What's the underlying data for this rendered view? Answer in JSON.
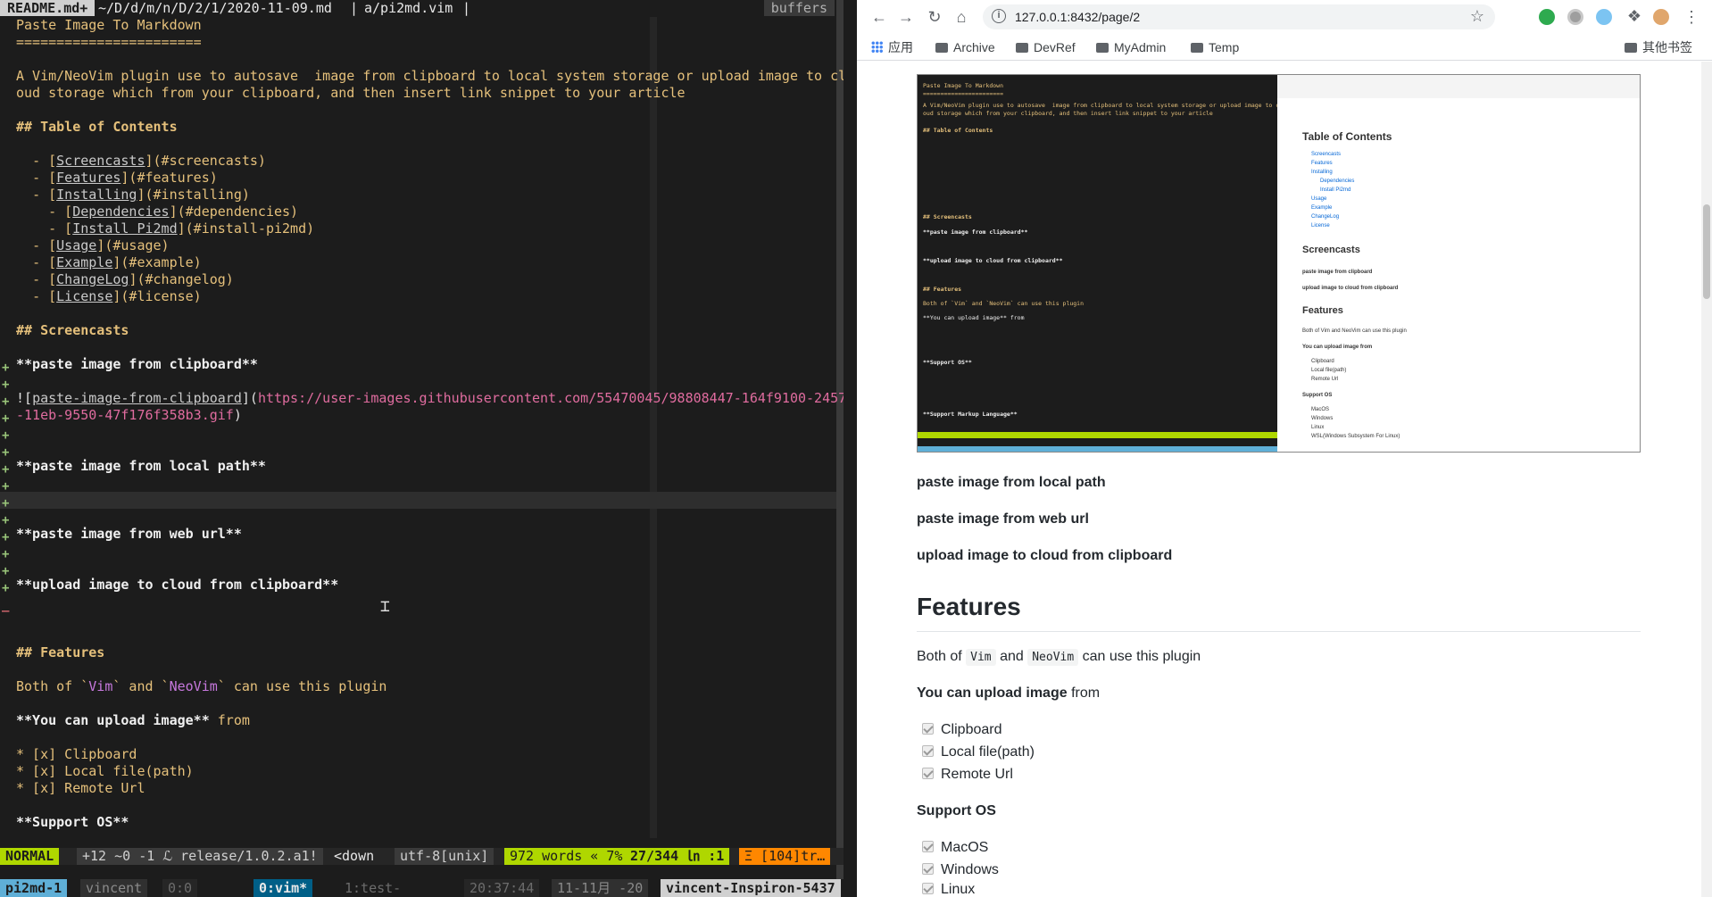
{
  "vim": {
    "tabline": {
      "active_tab": "README.md+",
      "path": "~/D/d/m/n/D/2/1/2020-11-09.md",
      "sep1": "|",
      "second_tab": "a/pi2md.vim",
      "sep2": "|",
      "buffers": "buffers"
    },
    "lines": {
      "l1": "Paste Image To Markdown",
      "l2": "=======================",
      "l3a": "A Vim/NeoVim plugin use to autosave  image from clipboard to local system storage or upload image to cl",
      "l3b": "oud storage which from your clipboard, and then insert link snippet to your article",
      "toc_heading": "## Table of Contents",
      "toc": [
        {
          "indent": "  ",
          "bracket_open": "- [",
          "label": "Screencasts",
          "target": "](#screencasts)"
        },
        {
          "indent": "  ",
          "bracket_open": "- [",
          "label": "Features",
          "target": "](#features)"
        },
        {
          "indent": "  ",
          "bracket_open": "- [",
          "label": "Installing",
          "target": "](#installing)"
        },
        {
          "indent": "    ",
          "bracket_open": "- [",
          "label": "Dependencies",
          "target": "](#dependencies)"
        },
        {
          "indent": "    ",
          "bracket_open": "- [",
          "label": "Install Pi2md",
          "target": "](#install-pi2md)"
        },
        {
          "indent": "  ",
          "bracket_open": "- [",
          "label": "Usage",
          "target": "](#usage)"
        },
        {
          "indent": "  ",
          "bracket_open": "- [",
          "label": "Example",
          "target": "](#example)"
        },
        {
          "indent": "  ",
          "bracket_open": "- [",
          "label": "ChangeLog",
          "target": "](#changelog)"
        },
        {
          "indent": "  ",
          "bracket_open": "- [",
          "label": "License",
          "target": "](#license)"
        }
      ],
      "screencasts": "## Screencasts",
      "paste_clipboard": "**paste image from clipboard**",
      "img_prefix": "![",
      "img_label": "paste-image-from-clipboard",
      "img_mid": "](",
      "img_url_a": "https://user-images.githubusercontent.com/55470045/98808447-164f9100-2457",
      "img_url_b": "-11eb-9550-47f176f358b3.gif",
      "img_close": ")",
      "paste_local": "**paste image from local path**",
      "paste_web": "**paste image from web url**",
      "upload_cloud": "**upload image to cloud from clipboard**",
      "features": "## Features",
      "both_a": "Both of `",
      "both_vim": "Vim",
      "both_b": "` and `",
      "both_neovim": "NeoVim",
      "both_c": "` can use this plugin",
      "upload_bold": "**You can upload image**",
      "upload_from": " from",
      "cb1": "* [x] Clipboard",
      "cb2": "* [x] Local file(path)",
      "cb3": "* [x] Remote Url",
      "support_os": "**Support OS**"
    },
    "statusline": {
      "mode": "NORMAL",
      "git": "+12 ~0 -1 ℒ release/1.0.2.a1!",
      "key": "<down",
      "encoding": "utf-8[unix]",
      "words": "972 words « 7%",
      "position": "27/344 ㏑ :1",
      "warn": "Ξ [104]tr…"
    },
    "tmux": {
      "session": "pi2md-1",
      "user": "vincent",
      "pane": "0:0",
      "window_active": "0:vim*",
      "window_other": "1:test-",
      "time": "20:37:44",
      "date": "11-11月 -20",
      "host": "vincent-Inspiron-5437"
    }
  },
  "browser": {
    "url": "127.0.0.1:8432/page/2",
    "bookmarks": [
      "应用",
      "Archive",
      "DevRef",
      "MyAdmin",
      "Temp"
    ],
    "other_bookmarks": "其他书签",
    "content": {
      "paste_local": "paste image from local path",
      "paste_web": "paste image from web url",
      "upload_cloud": "upload image to cloud from clipboard",
      "features_heading": "Features",
      "both_of": "Both of ",
      "code_vim": "Vim",
      "and": " and ",
      "code_neovim": "NeoVim",
      "can_use": " can use this plugin",
      "upload_bold": "You can upload image",
      "upload_from": " from",
      "upload_items": [
        "Clipboard",
        "Local file(path)",
        "Remote Url"
      ],
      "support_os_heading": "Support OS",
      "os_items": [
        "MacOS",
        "Windows",
        "Linux"
      ]
    },
    "embedded_screenshot": {
      "left_title": "Paste Image To Markdown",
      "left_rule": "=======================",
      "left_desc1": "A Vim/NeoVim plugin use to autosave  image from clipboard to local system storage or upload image to cl",
      "left_desc2": "oud storage which from your clipboard, and then insert link snippet to your article",
      "left_toc_heading": "## Table of Contents",
      "left_screencasts": "## Screencasts",
      "left_paste": "**paste image from clipboard**",
      "left_upload": "**upload image to cloud from clipboard**",
      "left_features": "## Features",
      "left_both": "Both of `Vim` and `NeoVim` can use this plugin",
      "left_upload2": "**You can upload image** from",
      "left_support": "**Support OS**",
      "left_markup": "**Support Markup Language**",
      "right_toc": "Table of Contents",
      "right_toc_items": [
        "Screencasts",
        "Features",
        "Installing",
        "Dependencies",
        "Install Pi2md",
        "Usage",
        "Example",
        "ChangeLog",
        "License"
      ],
      "right_screencasts": "Screencasts",
      "right_paste": "paste image from clipboard",
      "right_upload": "upload image to cloud from clipboard",
      "right_features": "Features",
      "right_both": "Both of Vim and NeoVim can use this plugin",
      "right_upload2": "You can upload image from",
      "right_upload_items": [
        "Clipboard",
        "Local file(path)",
        "Remote Url"
      ],
      "right_support": "Support OS",
      "right_os_items": [
        "MacOS",
        "Windows",
        "Linux",
        "WSL(Windows Subsystem For Linux)"
      ]
    }
  },
  "colors": {
    "vim_bg": "#1c1c1c",
    "vim_yellow": "#e5c07b",
    "mode_green": "#afd700",
    "status_orange": "#ff8700",
    "tmux_blue": "#5fafd7"
  }
}
